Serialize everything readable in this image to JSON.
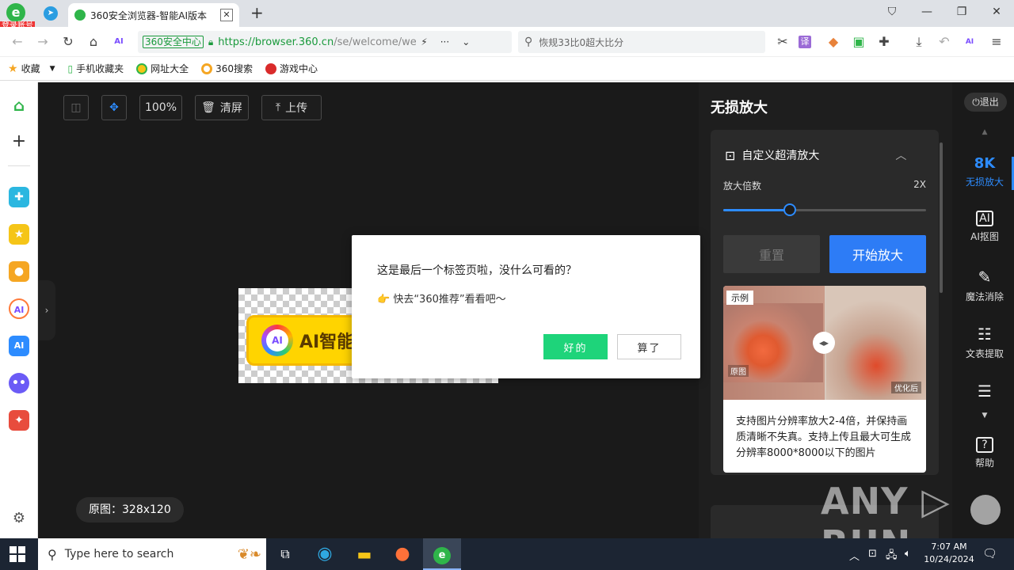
{
  "browser": {
    "login_badge": "登录账号",
    "tab_title": "360安全浏览器-智能AI版本",
    "tab_close": "✕",
    "new_tab": "+",
    "secure_label": "360安全中心",
    "url_main": "https://browser.360.cn",
    "url_rest": "/se/welcome/welc",
    "search_placeholder": "恢规33比0超大比分"
  },
  "bookmarks": [
    {
      "label": "收藏",
      "icon": "star-icon"
    },
    {
      "label": "手机收藏夹",
      "icon": "phone-icon"
    },
    {
      "label": "网址大全",
      "icon": "globe-icon"
    },
    {
      "label": "360搜索",
      "icon": "search360-icon"
    },
    {
      "label": "游戏中心",
      "icon": "game-icon"
    }
  ],
  "toolbar": {
    "zoom": "100%",
    "clear_label": "清屏",
    "upload_label": "上传"
  },
  "preview": {
    "ai_text": "AI智能助",
    "ai_logo": "AI"
  },
  "original_size": "原图：328x120",
  "dialog": {
    "question": "这是最后一个标签页啦，没什么可看的？",
    "tip": "👉 快去“360推荐”看看吧～",
    "ok_label": "好的",
    "cancel_label": "算了"
  },
  "panel": {
    "title": "无损放大",
    "section_title": "自定义超清放大",
    "magnification_label": "放大倍数",
    "magnification_value": "2X",
    "slider_fraction": 0.33,
    "reset_label": "重置",
    "start_label": "开始放大",
    "example_tag": "示例",
    "example_original": "原图",
    "example_optimized": "优化后",
    "description": "支持图片分辨率放大2-4倍，并保持画质清晰不失真。支持上传且最大可生成分辨率8000*8000以下的图片"
  },
  "rightbar": {
    "exit_label": "退出",
    "items": [
      {
        "label": "无损放大",
        "glyph": "8K"
      },
      {
        "label": "AI抠图",
        "glyph": "AI"
      },
      {
        "label": "魔法消除",
        "glyph": "✎"
      },
      {
        "label": "文表提取",
        "glyph": "☷"
      },
      {
        "label": "",
        "glyph": "☰"
      },
      {
        "label": "帮助",
        "glyph": "?"
      }
    ]
  },
  "watermark": "ANY ▷ RUN",
  "taskbar": {
    "search_placeholder": "Type here to search",
    "time": "7:07 AM",
    "date": "10/24/2024"
  },
  "colors": {
    "accent": "#2d8cff",
    "ok_green": "#1ed47a",
    "start_blue": "#2d7cf6",
    "canvas_bg": "#1a1a1a"
  }
}
